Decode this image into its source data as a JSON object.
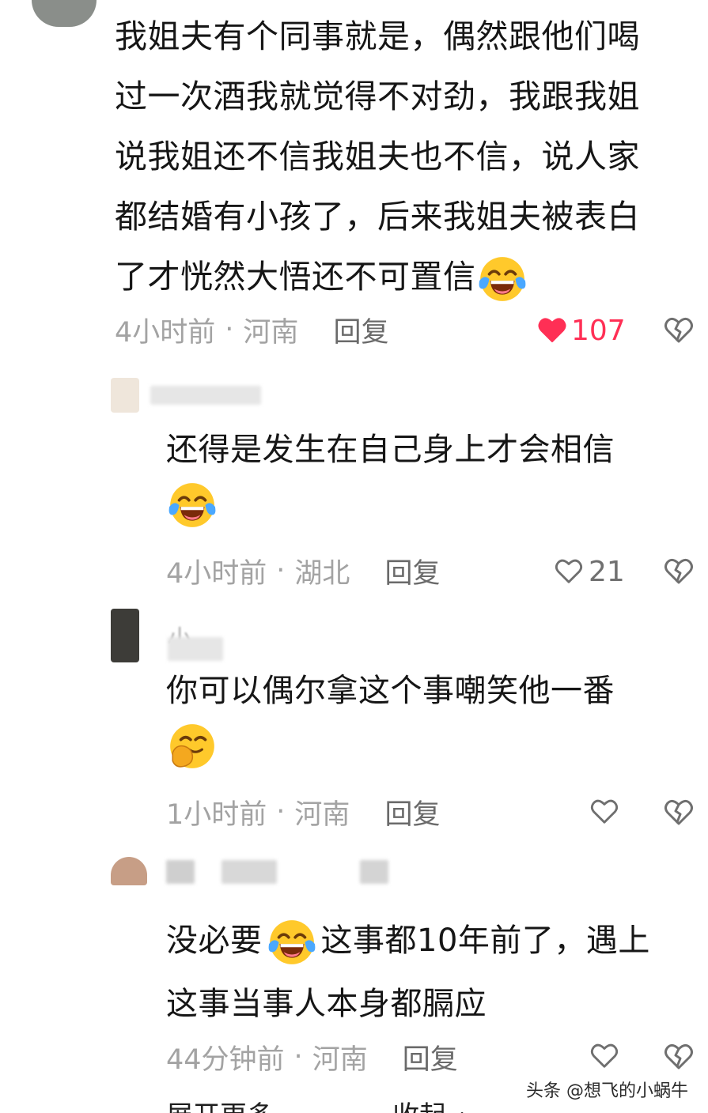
{
  "comment": {
    "text_lines": [
      "我姐夫有个同事就是，偶然跟他们喝",
      "过一次酒我就觉得不对劲，我跟我姐",
      "说我姐还不信我姐夫也不信，说人家",
      "都结婚有小孩了，后来我姐夫被表白",
      "了才恍然大悟还不可置信"
    ],
    "time": "4小时前",
    "location": "河南",
    "reply_label": "回复",
    "like_count": "107",
    "liked": true
  },
  "replies": [
    {
      "text_lines": [
        "还得是发生在自己身上才会相信"
      ],
      "time": "4小时前",
      "location": "湖北",
      "reply_label": "回复",
      "like_count": "21"
    },
    {
      "name_partial": "小",
      "text_lines": [
        "你可以偶尔拿这个事嘲笑他一番"
      ],
      "time": "1小时前",
      "location": "河南",
      "reply_label": "回复",
      "like_count": ""
    },
    {
      "text_line1_a": "没必要",
      "text_line1_b": "这事都10年前了，遇上",
      "text_line2": "这事当事人本身都膈应",
      "time": "44分钟前",
      "location": "河南",
      "reply_label": "回复",
      "like_count": ""
    }
  ],
  "footer": {
    "expand_label": "展开更多",
    "collapse_label": "收起"
  },
  "watermark": "头条 @想飞的小蜗牛",
  "dot_separator": "·",
  "icons": [
    "heart-icon",
    "broken-heart-icon",
    "tears-of-joy-emoji",
    "hand-over-mouth-emoji"
  ],
  "colors": {
    "liked": "#ff2f55",
    "meta": "#a3a3a3",
    "text": "#161616"
  }
}
